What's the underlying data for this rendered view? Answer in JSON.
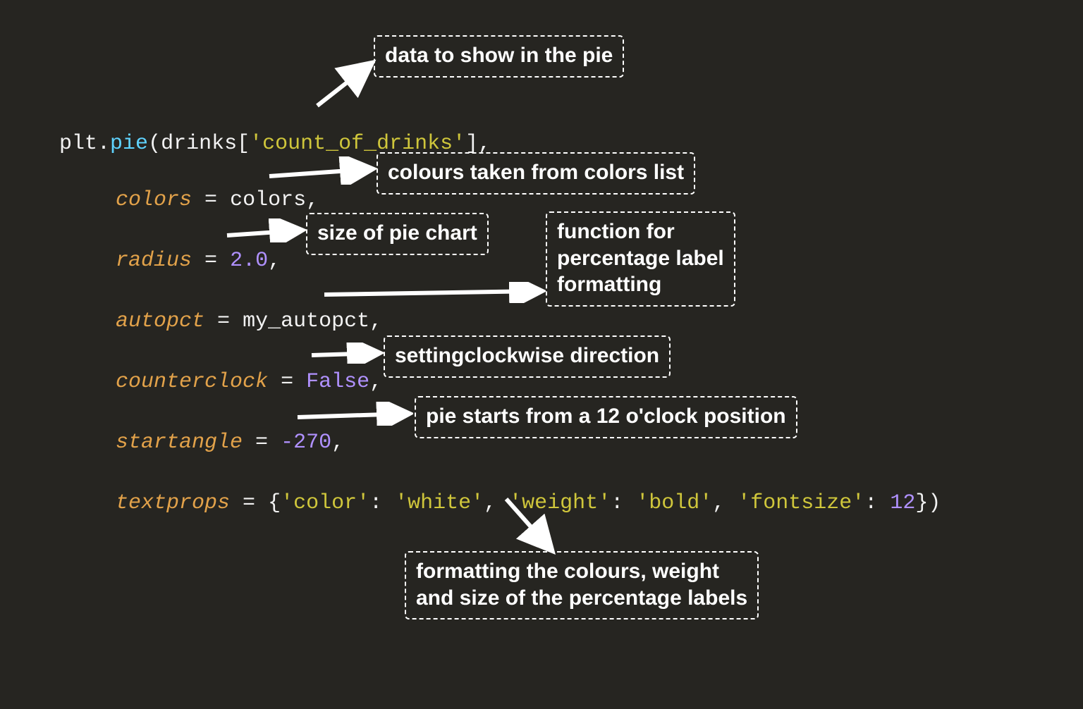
{
  "code": {
    "line1": {
      "plt": "plt",
      "dot": ".",
      "pie": "pie",
      "open": "(drinks[",
      "str": "'count_of_drinks'",
      "close": "],"
    },
    "line2": {
      "kw": "colors",
      "eq": " = ",
      "val": "colors",
      "comma": ","
    },
    "line3": {
      "kw": "radius",
      "eq": " = ",
      "val": "2.0",
      "comma": ","
    },
    "line4": {
      "kw": "autopct",
      "eq": " = ",
      "val": "my_autopct",
      "comma": ","
    },
    "line5": {
      "kw": "counterclock",
      "eq": " = ",
      "val": "False",
      "comma": ","
    },
    "line6": {
      "kw": "startangle",
      "eq": " = ",
      "val": "-270",
      "comma": ","
    },
    "line7": {
      "kw": "textprops",
      "eq": " = ",
      "open": "{",
      "k1": "'color'",
      "c1": ": ",
      "v1": "'white'",
      "sep1": ", ",
      "k2": "'weight'",
      "c2": ": ",
      "v2": "'bold'",
      "sep2": ", ",
      "k3": "'fontsize'",
      "c3": ": ",
      "v3": "12",
      "close": "})"
    }
  },
  "callouts": {
    "data": "data to show in the pie",
    "colors": "colours taken from colors list",
    "radius": "size of pie chart",
    "autopct": "function for\npercentage label\nformatting",
    "counter": "settingclockwise direction",
    "startangle": "pie starts from a 12 o'clock position",
    "textprops": "formatting the colours, weight\nand size of the percentage labels"
  }
}
